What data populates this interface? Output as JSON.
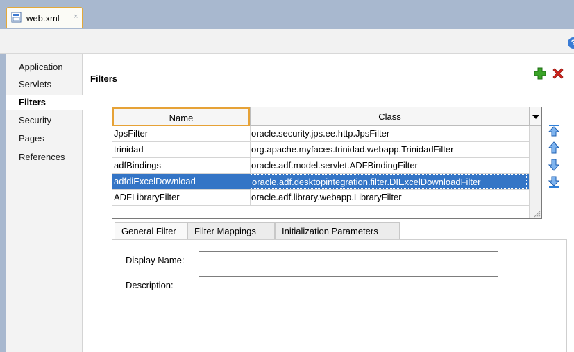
{
  "tabs": [
    {
      "title": "web.xml",
      "close": "×"
    }
  ],
  "help": {
    "icon": "help-icon",
    "glyph": "?"
  },
  "nav": {
    "items": [
      {
        "label": "Application",
        "active": false
      },
      {
        "label": "Servlets",
        "active": false
      },
      {
        "label": "Filters",
        "active": true
      },
      {
        "label": "Security",
        "active": false
      },
      {
        "label": "Pages",
        "active": false
      },
      {
        "label": "References",
        "active": false
      }
    ]
  },
  "section": {
    "title": "Filters",
    "add_icon": "add-icon",
    "delete_icon": "delete-icon"
  },
  "table": {
    "headers": [
      "Name",
      "Class"
    ],
    "rows": [
      {
        "name": "JpsFilter",
        "class": "oracle.security.jps.ee.http.JpsFilter",
        "selected": false
      },
      {
        "name": "trinidad",
        "class": "org.apache.myfaces.trinidad.webapp.TrinidadFilter",
        "selected": false
      },
      {
        "name": "adfBindings",
        "class": "oracle.adf.model.servlet.ADFBindingFilter",
        "selected": false
      },
      {
        "name": "adfdiExcelDownload",
        "class": "oracle.adf.desktopintegration.filter.DIExcelDownloadFilter",
        "selected": true
      },
      {
        "name": "ADFLibraryFilter",
        "class": "oracle.adf.library.webapp.LibraryFilter",
        "selected": false
      }
    ]
  },
  "reorder": [
    "move-top-icon",
    "move-up-icon",
    "move-down-icon",
    "move-bottom-icon"
  ],
  "subtabs": [
    {
      "label": "General Filter",
      "active": true
    },
    {
      "label": "Filter Mappings",
      "active": false
    },
    {
      "label": "Initialization Parameters",
      "active": false
    }
  ],
  "form": {
    "display_name_label": "Display Name:",
    "display_name_value": "",
    "description_label": "Description:",
    "description_value": ""
  },
  "colors": {
    "selection": "#3475c6",
    "tab_focus": "#e6a237",
    "add": "#3aa427",
    "delete": "#d8241c",
    "arrow": "#2f7fd8"
  }
}
